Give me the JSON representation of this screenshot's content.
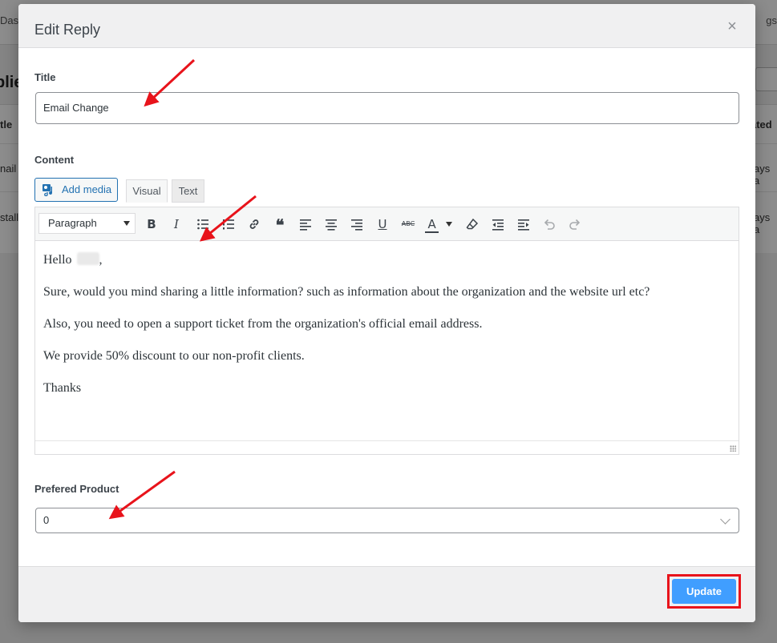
{
  "background": {
    "nav_left": "Dash",
    "nav_right": "gs",
    "heading": "plie",
    "table_header_left": "tle",
    "table_header_right": "ated",
    "row1_left": "nail",
    "row1_right": "ays a",
    "row2_left": "stall",
    "row2_right": "ays a"
  },
  "modal": {
    "title": "Edit Reply",
    "close_icon": "×"
  },
  "title_field": {
    "label": "Title",
    "value": "Email Change"
  },
  "content_field": {
    "label": "Content",
    "add_media_label": "Add media",
    "tabs": [
      "Visual",
      "Text"
    ],
    "format_value": "Paragraph",
    "toolbar_icons": [
      "bold-icon",
      "italic-icon",
      "bulleted-list-icon",
      "numbered-list-icon",
      "link-icon",
      "blockquote-icon",
      "align-left-icon",
      "align-center-icon",
      "align-right-icon",
      "underline-icon",
      "strikethrough-icon",
      "text-color-icon",
      "clear-formatting-icon",
      "outdent-icon",
      "indent-icon",
      "undo-icon",
      "redo-icon"
    ],
    "paragraphs": {
      "p1": "Hello",
      "p1_suffix": ",",
      "p2": "Sure, would you mind sharing a little information? such as information about the organization and the website url etc?",
      "p3": "Also, you need to open a support ticket from the organization's official email address.",
      "p4": "We provide 50% discount to our non-profit clients.",
      "p5": "Thanks"
    }
  },
  "product_field": {
    "label": "Prefered Product",
    "value": "0"
  },
  "footer": {
    "update_label": "Update"
  },
  "colors": {
    "accent": "#409eff",
    "highlight": "#e8131b",
    "link": "#2271b1"
  }
}
